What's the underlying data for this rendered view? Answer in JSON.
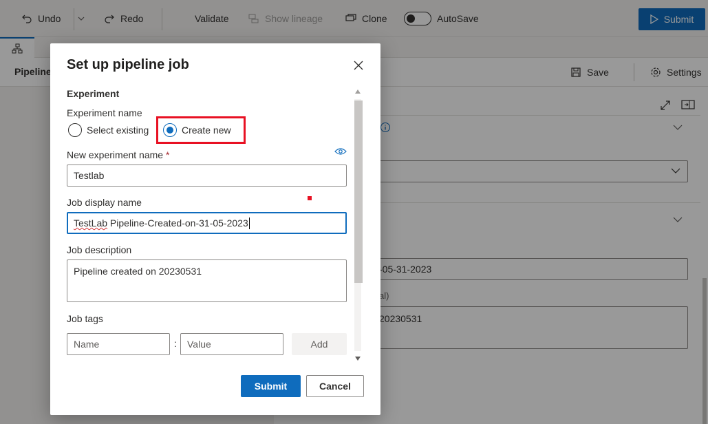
{
  "toolbar": {
    "undo": "Undo",
    "redo": "Redo",
    "validate": "Validate",
    "show_lineage": "Show lineage",
    "clone": "Clone",
    "autosave": "AutoSave",
    "autosave_on": false,
    "submit": "Submit"
  },
  "subbar": {
    "title": "Pipeline",
    "save": "Save",
    "settings": "Settings"
  },
  "right_panel": {
    "display_name_fragment": "-05-31-2023",
    "description_label_fragment": "al)",
    "description_fragment": "20230531"
  },
  "dialog": {
    "title": "Set up pipeline job",
    "experiment_section": "Experiment",
    "experiment_name_label": "Experiment name",
    "radio_options": [
      {
        "label": "Select existing",
        "checked": false
      },
      {
        "label": "Create new",
        "checked": true
      }
    ],
    "new_experiment_label": "New experiment name",
    "required_mark": "*",
    "new_experiment_value": "Testlab",
    "job_display_name_label": "Job display name",
    "job_display_name_spell": "TestLab",
    "job_display_name_rest": " Pipeline-Created-on-31-05-2023",
    "job_description_label": "Job description",
    "job_description_value": "Pipeline created on 20230531",
    "job_tags_label": "Job tags",
    "tag_name_placeholder": "Name",
    "tag_separator": ":",
    "tag_value_placeholder": "Value",
    "add_button": "Add",
    "submit_button": "Submit",
    "cancel_button": "Cancel"
  },
  "colors": {
    "accent": "#0f6cbd",
    "highlight": "#e81123",
    "overlay": "rgba(0,0,0,0.40)"
  }
}
